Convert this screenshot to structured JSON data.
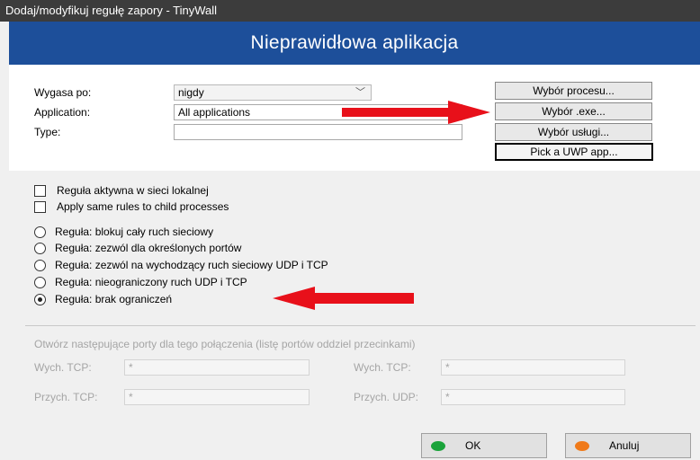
{
  "window": {
    "title": "Dodaj/modyfikuj regułę zapory - TinyWall"
  },
  "banner": {
    "text": "Nieprawidłowa aplikacja"
  },
  "form": {
    "expires_label": "Wygasa po:",
    "expires_value": "nigdy",
    "application_label": "Application:",
    "application_value": "All applications",
    "type_label": "Type:",
    "type_value": ""
  },
  "buttons": {
    "pick_process": "Wybór procesu...",
    "pick_exe": "Wybór .exe...",
    "pick_service": "Wybór usługi...",
    "pick_uwp": "Pick a UWP app..."
  },
  "options": {
    "checkboxes": [
      {
        "label": "Reguła aktywna w sieci lokalnej",
        "checked": false
      },
      {
        "label": "Apply same rules to child processes",
        "checked": false
      }
    ],
    "radios": [
      {
        "label": "Reguła: blokuj cały ruch sieciowy",
        "selected": false
      },
      {
        "label": "Reguła: zezwól dla określonych portów",
        "selected": false
      },
      {
        "label": "Reguła: zezwól na wychodzący ruch sieciowy UDP i TCP",
        "selected": false
      },
      {
        "label": "Reguła: nieograniczony ruch UDP i TCP",
        "selected": false
      },
      {
        "label": "Reguła: brak ograniczeń",
        "selected": true
      }
    ]
  },
  "ports": {
    "title": "Otwórz następujące porty dla tego połączenia (listę portów oddziel przecinkami)",
    "out_tcp_label": "Wych. TCP:",
    "out_tcp_value": "*",
    "out_udp_label": "Wych. TCP:",
    "out_udp_value": "*",
    "in_tcp_label": "Przych. TCP:",
    "in_tcp_value": "*",
    "in_udp_label": "Przych. UDP:",
    "in_udp_value": "*"
  },
  "footer": {
    "ok_label": "OK",
    "cancel_label": "Anuluj"
  },
  "colors": {
    "titlebar": "#3c3c3c",
    "banner": "#1d4f9a",
    "arrow": "#e8101a",
    "ok_icon": "#1aa33a",
    "cancel_icon": "#f07a1a"
  },
  "icons": {
    "chevron": "chevron-down-icon",
    "annotation": "red-arrow-icon"
  }
}
